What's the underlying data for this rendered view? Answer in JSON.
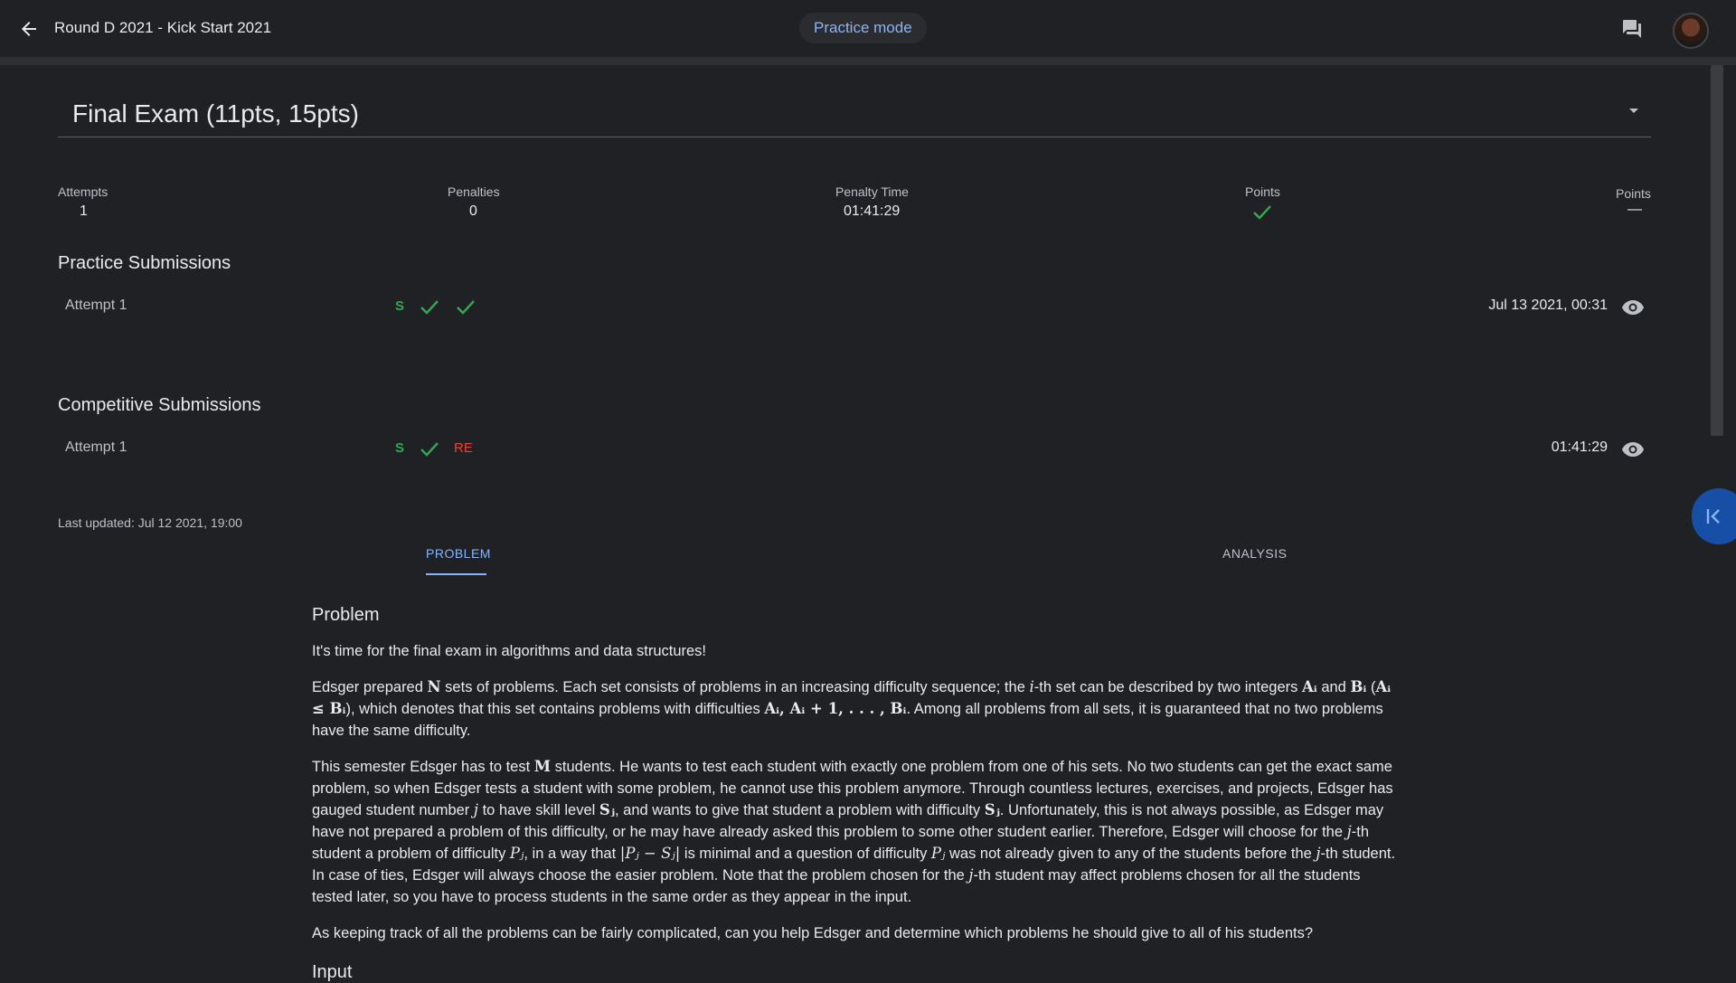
{
  "topbar": {
    "title": "Round D 2021 - Kick Start 2021",
    "mode": "Practice mode",
    "back_icon": "arrow-back-icon",
    "chat_icon": "chat-icon"
  },
  "problem_header": {
    "title": "Final Exam (11pts, 15pts)"
  },
  "stats": {
    "attempts_label": "Attempts",
    "attempts_value": "1",
    "penalties_label": "Penalties",
    "penalties_value": "0",
    "penalty_time_label": "Penalty Time",
    "penalty_time_value": "01:41:29",
    "points_label_1": "Points",
    "points_label_2": "Points",
    "points_value_2": "—"
  },
  "practice": {
    "heading": "Practice Submissions",
    "attempt_label": "Attempt 1",
    "badge": "S",
    "time": "Jul 13 2021, 00:31"
  },
  "competitive": {
    "heading": "Competitive Submissions",
    "attempt_label": "Attempt 1",
    "badge": "S",
    "result2": "RE",
    "time": "01:41:29"
  },
  "last_updated": "Last updated: Jul 12 2021, 19:00",
  "tabs": {
    "problem": "PROBLEM",
    "analysis": "ANALYSIS"
  },
  "statement": {
    "heading": "Problem",
    "p1": "It's time for the final exam in algorithms and data structures!",
    "p2a": "Edsger prepared ",
    "p2b": " sets of problems. Each set consists of problems in an increasing difficulty sequence; the ",
    "p2c": "-th set can be described by two integers ",
    "p2d": " and ",
    "p2e": " (",
    "p2f": "), which denotes that this set contains problems with difficulties ",
    "p2g": ". Among all problems from all sets, it is guaranteed that no two problems have the same difficulty.",
    "p3a": "This semester Edsger has to test ",
    "p3b": " students. He wants to test each student with exactly one problem from one of his sets. No two students can get the exact same problem, so when Edsger tests a student with some problem, he cannot use this problem anymore. Through countless lectures, exercises, and projects, Edsger has gauged student number ",
    "p3c": " to have skill level ",
    "p3d": ", and wants to give that student a problem with difficulty ",
    "p3e": ". Unfortunately, this is not always possible, as Edsger may have not prepared a problem of this difficulty, or he may have already asked this problem to some other student earlier. Therefore, Edsger will choose for the ",
    "p3f": "-th student a problem of difficulty ",
    "p3g": ", in a way that ",
    "p3h": " is minimal and a question of difficulty ",
    "p3i": " was not already given to any of the students before the ",
    "p3j": "-th student. In case of ties, Edsger will always choose the easier problem. Note that the problem chosen for the ",
    "p3k": "-th student may affect problems chosen for all the students tested later, so you have to process students in the same order as they appear in the input.",
    "p4": "As keeping track of all the problems can be fairly complicated, can you help Edsger and determine which problems he should give to all of his students?",
    "math_N": "N",
    "math_i": "i",
    "math_Ai": "Aᵢ",
    "math_Bi": "Bᵢ",
    "math_AleB": "Aᵢ ≤ Bᵢ",
    "math_range": "Aᵢ, Aᵢ + 1, . . . , Bᵢ",
    "math_M": "M",
    "math_j": "j",
    "math_Sj": "Sⱼ",
    "math_Pj": "Pⱼ",
    "math_abs": "|Pⱼ − Sⱼ|",
    "input_heading": "Input"
  },
  "colors": {
    "accent": "#8ab4f8",
    "success": "#34a853",
    "error": "#ea4335",
    "background": "#202124"
  }
}
